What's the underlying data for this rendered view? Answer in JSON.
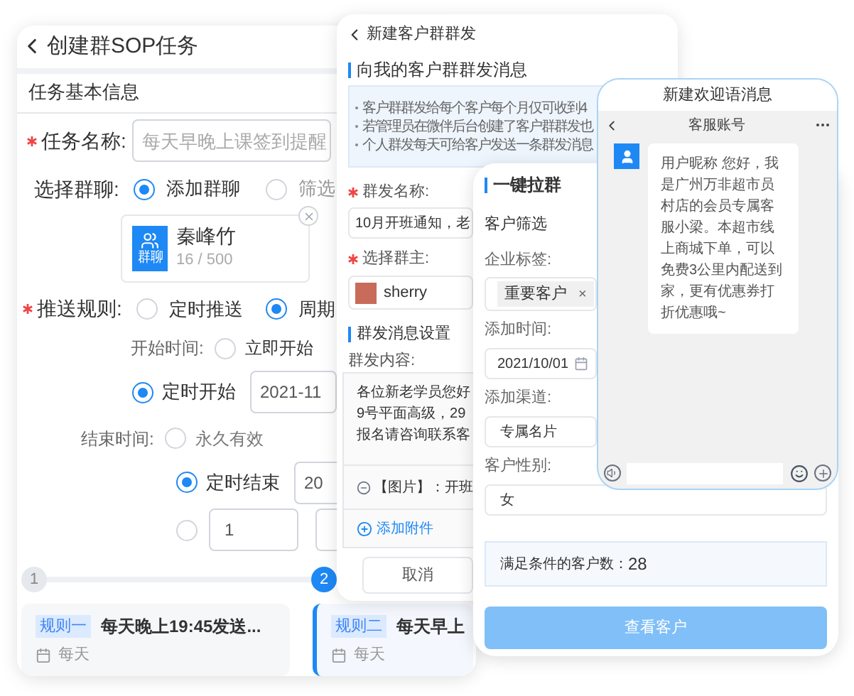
{
  "task_panel": {
    "title": "创建群SOP任务",
    "section": "任务基本信息",
    "name_field": {
      "label": "任务名称:",
      "required": true,
      "placeholder": "每天早晚上课签到提醒"
    },
    "group_select": {
      "label": "选择群聊:",
      "options": [
        {
          "label": "添加群聊",
          "selected": true
        },
        {
          "label": "筛选",
          "selected": false
        }
      ]
    },
    "group_card": {
      "avatar_label": "群聊",
      "name": "秦峰竹",
      "count": "16 / 500"
    },
    "push_rule": {
      "label": "推送规则:",
      "required": true,
      "options": [
        {
          "label": "定时推送",
          "selected": false
        },
        {
          "label": "周期",
          "selected": true
        }
      ]
    },
    "start_time": {
      "label": "开始时间:",
      "options": [
        {
          "label": "立即开始",
          "selected": false
        },
        {
          "label": "定时开始",
          "selected": true,
          "value": "2021-11"
        }
      ]
    },
    "end_time": {
      "label": "结束时间:",
      "options": [
        {
          "label": "永久有效",
          "selected": false
        },
        {
          "label": "定时结束",
          "selected": true,
          "value": "20"
        },
        {
          "selected": false,
          "value": "1"
        }
      ]
    },
    "steps": [
      {
        "number": "1",
        "selected": false
      },
      {
        "number": "2",
        "selected": true
      }
    ],
    "rules": [
      {
        "tag": "规则一",
        "title": "每天晚上19:45发送...",
        "repeat": "每天",
        "selected": false
      },
      {
        "tag": "规则二",
        "title": "每天早上",
        "repeat": "每天",
        "selected": true
      }
    ]
  },
  "broadcast_panel": {
    "title": "新建客户群群发",
    "section": "向我的客户群群发消息",
    "notes": [
      "客户群群发给每个客户每个月仅可收到4",
      "若管理员在微伴后台创建了客户群群发也",
      "个人群发每天可给客户发送一条群发消息"
    ],
    "name_field": {
      "label": "群发名称:",
      "required": true,
      "value": "10月开班通知，老"
    },
    "owner_field": {
      "label": "选择群主:",
      "required": true,
      "value": "sherry"
    },
    "settings_section": "群发消息设置",
    "content_label": "群发内容:",
    "content_lines": [
      "各位新老学员您好",
      "9号平面高级，29",
      "报名请咨询联系客"
    ],
    "attachment": "【图片】：开班",
    "add_attachment": "添加附件",
    "cancel": "取消"
  },
  "group_pull_panel": {
    "section": "一键拉群",
    "filter_title": "客户筛选",
    "tag_field": {
      "label": "企业标签:",
      "tags": [
        {
          "label": "重要客户",
          "remove": "×"
        }
      ]
    },
    "date_field": {
      "label": "添加时间:",
      "value": "2021/10/01"
    },
    "channel_field": {
      "label": "添加渠道:",
      "value": "专属名片"
    },
    "gender_field": {
      "label": "客户性别:",
      "value": "女"
    },
    "count": {
      "label": "满足条件的客户数：",
      "value": "28"
    },
    "button": "查看客户"
  },
  "welcome_panel": {
    "title": "新建欢迎语消息",
    "chat_title": "客服账号",
    "message": "用户昵称 您好，我是广州万非超市员村店的会员专属客服小梁。本超市线上商城下单，可以免费3公里内配送到家，更有优惠券打折优惠哦~"
  }
}
